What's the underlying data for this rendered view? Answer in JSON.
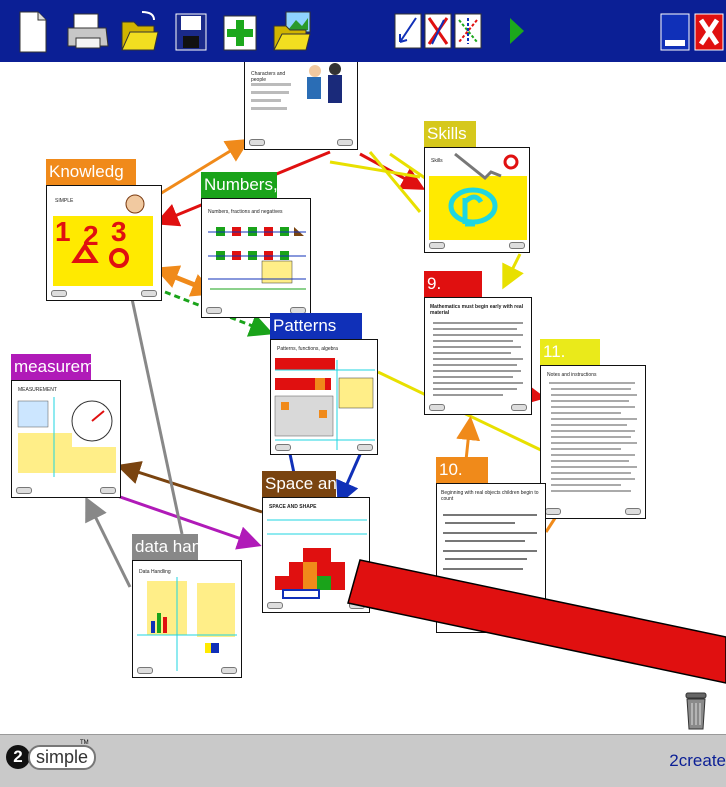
{
  "toolbar": {
    "icons": [
      "new-page-icon",
      "print-icon",
      "open-folder-icon",
      "save-disk-icon",
      "add-page-icon",
      "open-picture-folder-icon",
      "link-arrows-icon",
      "delete-link-icon",
      "swap-links-icon",
      "play-icon",
      "minimize-icon",
      "close-icon"
    ],
    "colors": {
      "bar": "#0b1f95",
      "close": "#e01010",
      "play": "#1ca81c"
    }
  },
  "pages": [
    {
      "id": "top",
      "label": ""
    },
    {
      "id": "knowledge",
      "label": "Knowledg",
      "color": "#f08a1a"
    },
    {
      "id": "numbers",
      "label": "Numbers,",
      "color": "#1aa31a"
    },
    {
      "id": "skills",
      "label": "Skills",
      "color": "#d6c81c"
    },
    {
      "id": "nine",
      "label": "9.",
      "color": "#e01010"
    },
    {
      "id": "patterns",
      "label": "Patterns",
      "color": "#1030b8"
    },
    {
      "id": "measurement",
      "label": "measurem",
      "color": "#b01ab8"
    },
    {
      "id": "eleven",
      "label": "11.",
      "color": "#eaea1a"
    },
    {
      "id": "ten",
      "label": "10.",
      "color": "#f08a1a"
    },
    {
      "id": "space",
      "label": "Space an",
      "color": "#7a4410"
    },
    {
      "id": "datahandling",
      "label": "data han",
      "color": "#888888"
    }
  ],
  "thumbnails": {
    "knowledge_heading": "SIMPLE",
    "knowledge_numbers": [
      "1",
      "2",
      "3"
    ],
    "numbers_heading": "Numbers, fractions and negatives",
    "patterns_heading": "Patterns, functions, algebra",
    "measurement_heading": "MEASUREMENT",
    "space_heading": "SPACE AND SHAPE",
    "data_heading": "Data Handling",
    "skills_heading": "Skills",
    "nine_text": "Mathematics must begin early with real material",
    "ten_text": "Beginning with real objects children begin to count",
    "eleven_text": "Notes and instructions",
    "top_text": "Characters and people"
  },
  "footer": {
    "logo_num": "2",
    "logo_word": "simple",
    "trademark": "TM",
    "brand": "2create"
  }
}
